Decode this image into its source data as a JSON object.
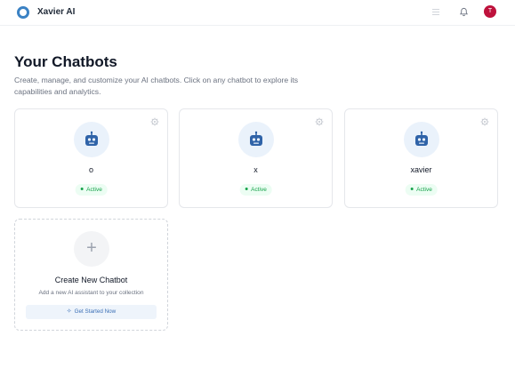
{
  "app": {
    "title": "Xavier AI"
  },
  "header": {
    "avatar_initial": "T"
  },
  "page": {
    "title": "Your Chatbots",
    "subtitle": "Create, manage, and customize your AI chatbots. Click on any chatbot to explore its capabilities and analytics."
  },
  "chatbots": [
    {
      "name": "o",
      "status": "Active"
    },
    {
      "name": "x",
      "status": "Active"
    },
    {
      "name": "xavier",
      "status": "Active"
    }
  ],
  "create_card": {
    "icon": "+",
    "title": "Create New Chatbot",
    "subtitle": "Add a new AI assistant to your collection",
    "button_label": "Get Started Now"
  },
  "colors": {
    "accent": "#3b82c4",
    "status_active": "#16a34a",
    "avatar": "#be123c"
  }
}
